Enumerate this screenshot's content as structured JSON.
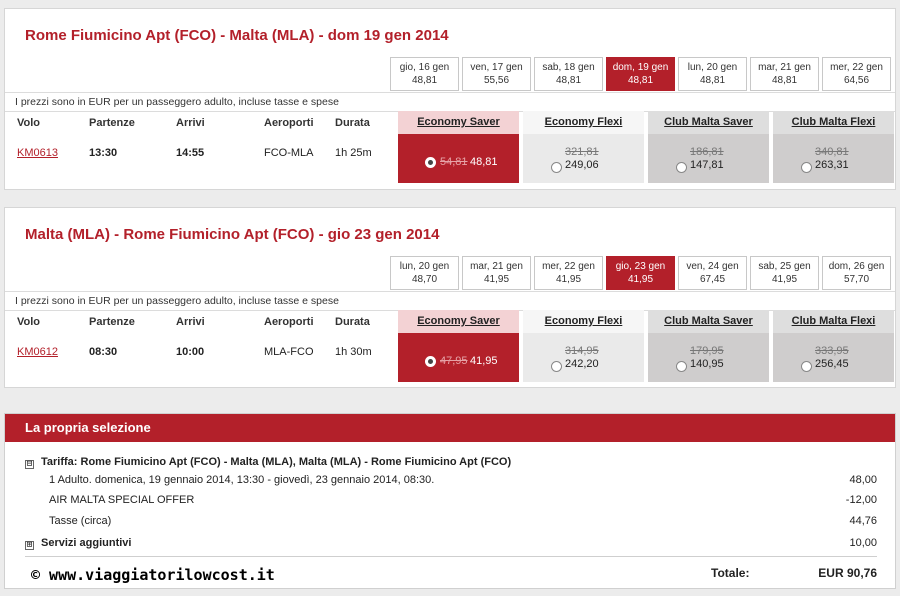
{
  "outbound": {
    "title": "Rome Fiumicino Apt (FCO) - Malta (MLA) - dom 19 gen 2014",
    "dates": [
      {
        "label": "gio, 16 gen",
        "price": "48,81"
      },
      {
        "label": "ven, 17 gen",
        "price": "55,56"
      },
      {
        "label": "sab, 18 gen",
        "price": "48,81"
      },
      {
        "label": "dom, 19 gen",
        "price": "48,81"
      },
      {
        "label": "lun, 20 gen",
        "price": "48,81"
      },
      {
        "label": "mar, 21 gen",
        "price": "48,81"
      },
      {
        "label": "mer, 22 gen",
        "price": "64,56"
      }
    ],
    "selected_date_index": 3,
    "info": "I prezzi sono in EUR per un passeggero adulto, incluse tasse e spese",
    "columns": {
      "flight": "Volo",
      "departure": "Partenze",
      "arrival": "Arrivi",
      "airports": "Aeroporti",
      "duration": "Durata"
    },
    "fares": [
      "Economy Saver",
      "Economy Flexi",
      "Club Malta Saver",
      "Club Malta Flexi"
    ],
    "row": {
      "flight": "KM0613",
      "departure": "13:30",
      "arrival": "14:55",
      "airports": "FCO-MLA",
      "duration": "1h 25m",
      "prices": [
        {
          "old": "54,81",
          "new": "48,81",
          "selected": true
        },
        {
          "old": "321,81",
          "new": "249,06",
          "selected": false
        },
        {
          "old": "186,81",
          "new": "147,81",
          "selected": false
        },
        {
          "old": "340,81",
          "new": "263,31",
          "selected": false
        }
      ]
    }
  },
  "return": {
    "title": "Malta (MLA) - Rome Fiumicino Apt (FCO) - gio 23 gen 2014",
    "dates": [
      {
        "label": "lun, 20 gen",
        "price": "48,70"
      },
      {
        "label": "mar, 21 gen",
        "price": "41,95"
      },
      {
        "label": "mer, 22 gen",
        "price": "41,95"
      },
      {
        "label": "gio, 23 gen",
        "price": "41,95"
      },
      {
        "label": "ven, 24 gen",
        "price": "67,45"
      },
      {
        "label": "sab, 25 gen",
        "price": "41,95"
      },
      {
        "label": "dom, 26 gen",
        "price": "57,70"
      }
    ],
    "selected_date_index": 3,
    "info": "I prezzi sono in EUR per un passeggero adulto, incluse tasse e spese",
    "columns": {
      "flight": "Volo",
      "departure": "Partenze",
      "arrival": "Arrivi",
      "airports": "Aeroporti",
      "duration": "Durata"
    },
    "fares": [
      "Economy Saver",
      "Economy Flexi",
      "Club Malta Saver",
      "Club Malta Flexi"
    ],
    "row": {
      "flight": "KM0612",
      "departure": "08:30",
      "arrival": "10:00",
      "airports": "MLA-FCO",
      "duration": "1h 30m",
      "prices": [
        {
          "old": "47,95",
          "new": "41,95",
          "selected": true
        },
        {
          "old": "314,95",
          "new": "242,20",
          "selected": false
        },
        {
          "old": "179,95",
          "new": "140,95",
          "selected": false
        },
        {
          "old": "333,95",
          "new": "256,45",
          "selected": false
        }
      ]
    }
  },
  "selection": {
    "header": "La propria selezione",
    "tariff_toggle": "⊟",
    "tariff_label": "Tariffa: Rome Fiumicino Apt (FCO) - Malta (MLA), Malta (MLA) - Rome Fiumicino Apt (FCO)",
    "lines": [
      {
        "label": "1 Adulto. domenica, 19 gennaio 2014, 13:30 - giovedì, 23 gennaio 2014, 08:30.",
        "amount": "48,00"
      },
      {
        "label": "AIR MALTA SPECIAL OFFER",
        "amount": "-12,00"
      },
      {
        "label": "Tasse (circa)",
        "amount": "44,76"
      }
    ],
    "services_toggle": "⊞",
    "services_label": "Servizi aggiuntivi",
    "services_amount": "10,00",
    "total_label": "Totale:",
    "total_value": "EUR 90,76"
  },
  "watermark": "© www.viaggiatorilowcost.it",
  "colors": {
    "accent": "#b3202a"
  }
}
